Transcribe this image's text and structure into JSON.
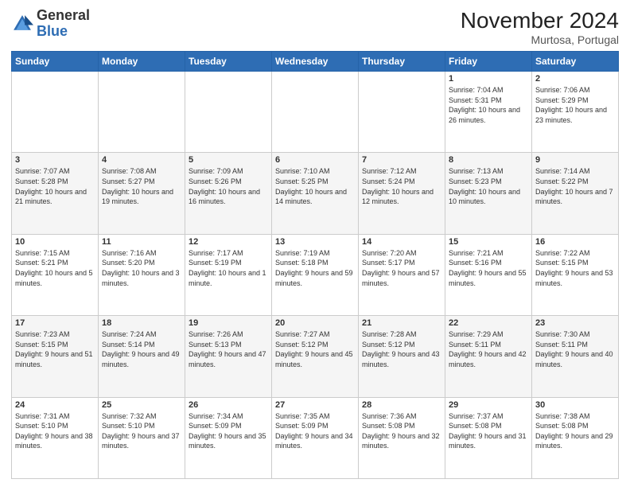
{
  "logo": {
    "general": "General",
    "blue": "Blue"
  },
  "header": {
    "month": "November 2024",
    "location": "Murtosa, Portugal"
  },
  "weekdays": [
    "Sunday",
    "Monday",
    "Tuesday",
    "Wednesday",
    "Thursday",
    "Friday",
    "Saturday"
  ],
  "weeks": [
    [
      {
        "day": "",
        "info": ""
      },
      {
        "day": "",
        "info": ""
      },
      {
        "day": "",
        "info": ""
      },
      {
        "day": "",
        "info": ""
      },
      {
        "day": "",
        "info": ""
      },
      {
        "day": "1",
        "info": "Sunrise: 7:04 AM\nSunset: 5:31 PM\nDaylight: 10 hours and 26 minutes."
      },
      {
        "day": "2",
        "info": "Sunrise: 7:06 AM\nSunset: 5:29 PM\nDaylight: 10 hours and 23 minutes."
      }
    ],
    [
      {
        "day": "3",
        "info": "Sunrise: 7:07 AM\nSunset: 5:28 PM\nDaylight: 10 hours and 21 minutes."
      },
      {
        "day": "4",
        "info": "Sunrise: 7:08 AM\nSunset: 5:27 PM\nDaylight: 10 hours and 19 minutes."
      },
      {
        "day": "5",
        "info": "Sunrise: 7:09 AM\nSunset: 5:26 PM\nDaylight: 10 hours and 16 minutes."
      },
      {
        "day": "6",
        "info": "Sunrise: 7:10 AM\nSunset: 5:25 PM\nDaylight: 10 hours and 14 minutes."
      },
      {
        "day": "7",
        "info": "Sunrise: 7:12 AM\nSunset: 5:24 PM\nDaylight: 10 hours and 12 minutes."
      },
      {
        "day": "8",
        "info": "Sunrise: 7:13 AM\nSunset: 5:23 PM\nDaylight: 10 hours and 10 minutes."
      },
      {
        "day": "9",
        "info": "Sunrise: 7:14 AM\nSunset: 5:22 PM\nDaylight: 10 hours and 7 minutes."
      }
    ],
    [
      {
        "day": "10",
        "info": "Sunrise: 7:15 AM\nSunset: 5:21 PM\nDaylight: 10 hours and 5 minutes."
      },
      {
        "day": "11",
        "info": "Sunrise: 7:16 AM\nSunset: 5:20 PM\nDaylight: 10 hours and 3 minutes."
      },
      {
        "day": "12",
        "info": "Sunrise: 7:17 AM\nSunset: 5:19 PM\nDaylight: 10 hours and 1 minute."
      },
      {
        "day": "13",
        "info": "Sunrise: 7:19 AM\nSunset: 5:18 PM\nDaylight: 9 hours and 59 minutes."
      },
      {
        "day": "14",
        "info": "Sunrise: 7:20 AM\nSunset: 5:17 PM\nDaylight: 9 hours and 57 minutes."
      },
      {
        "day": "15",
        "info": "Sunrise: 7:21 AM\nSunset: 5:16 PM\nDaylight: 9 hours and 55 minutes."
      },
      {
        "day": "16",
        "info": "Sunrise: 7:22 AM\nSunset: 5:15 PM\nDaylight: 9 hours and 53 minutes."
      }
    ],
    [
      {
        "day": "17",
        "info": "Sunrise: 7:23 AM\nSunset: 5:15 PM\nDaylight: 9 hours and 51 minutes."
      },
      {
        "day": "18",
        "info": "Sunrise: 7:24 AM\nSunset: 5:14 PM\nDaylight: 9 hours and 49 minutes."
      },
      {
        "day": "19",
        "info": "Sunrise: 7:26 AM\nSunset: 5:13 PM\nDaylight: 9 hours and 47 minutes."
      },
      {
        "day": "20",
        "info": "Sunrise: 7:27 AM\nSunset: 5:12 PM\nDaylight: 9 hours and 45 minutes."
      },
      {
        "day": "21",
        "info": "Sunrise: 7:28 AM\nSunset: 5:12 PM\nDaylight: 9 hours and 43 minutes."
      },
      {
        "day": "22",
        "info": "Sunrise: 7:29 AM\nSunset: 5:11 PM\nDaylight: 9 hours and 42 minutes."
      },
      {
        "day": "23",
        "info": "Sunrise: 7:30 AM\nSunset: 5:11 PM\nDaylight: 9 hours and 40 minutes."
      }
    ],
    [
      {
        "day": "24",
        "info": "Sunrise: 7:31 AM\nSunset: 5:10 PM\nDaylight: 9 hours and 38 minutes."
      },
      {
        "day": "25",
        "info": "Sunrise: 7:32 AM\nSunset: 5:10 PM\nDaylight: 9 hours and 37 minutes."
      },
      {
        "day": "26",
        "info": "Sunrise: 7:34 AM\nSunset: 5:09 PM\nDaylight: 9 hours and 35 minutes."
      },
      {
        "day": "27",
        "info": "Sunrise: 7:35 AM\nSunset: 5:09 PM\nDaylight: 9 hours and 34 minutes."
      },
      {
        "day": "28",
        "info": "Sunrise: 7:36 AM\nSunset: 5:08 PM\nDaylight: 9 hours and 32 minutes."
      },
      {
        "day": "29",
        "info": "Sunrise: 7:37 AM\nSunset: 5:08 PM\nDaylight: 9 hours and 31 minutes."
      },
      {
        "day": "30",
        "info": "Sunrise: 7:38 AM\nSunset: 5:08 PM\nDaylight: 9 hours and 29 minutes."
      }
    ]
  ]
}
